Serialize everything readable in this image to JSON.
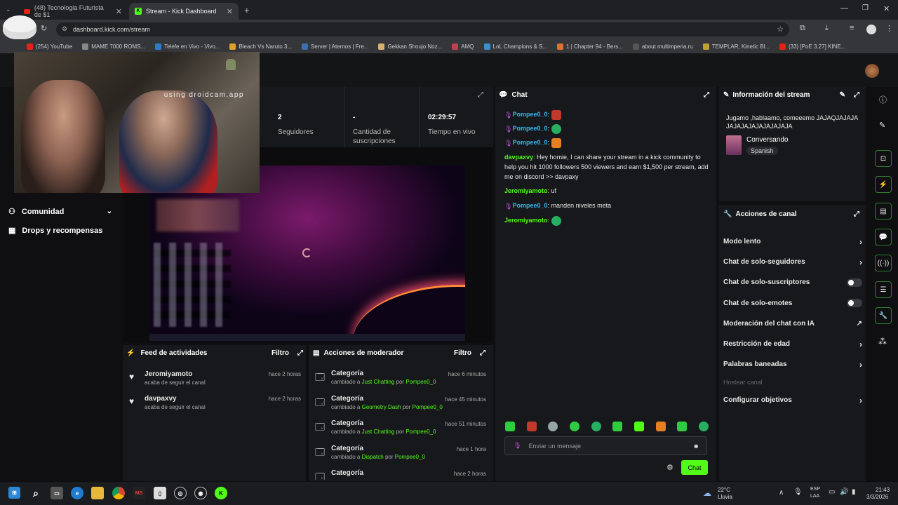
{
  "browser": {
    "tabs": [
      {
        "label": "(48) Tecnologia Futurista de $1",
        "active": false,
        "favicon": "youtube-icon"
      },
      {
        "label": "Stream - Kick Dashboard",
        "active": true,
        "favicon": "kick-icon"
      }
    ],
    "url": "dashboard.kick.com/stream",
    "bookmarks": [
      "(254) YouTube",
      "MAME 7000 ROMS...",
      "Telefe en Vivo - Vivo...",
      "Bleach Vs Naruto 3...",
      "Server | Aternos | Fre...",
      "Gekkan Shoujo Noz...",
      "AMQ",
      "LoL Champions & S...",
      "1 | Chapter 94 - Bers...",
      "about multimperia.ru",
      "TEMPLAR, Kinetic Bl...",
      "(33) [PoE 3.27] KINE..."
    ]
  },
  "webcam": {
    "overlay_text": "using droidcam.app"
  },
  "stats": [
    {
      "value": "2",
      "label": "Seguidores"
    },
    {
      "value": "-",
      "label": "Cantidad de suscripciones"
    },
    {
      "value": "02:29:57",
      "label": "Tiempo en vivo"
    }
  ],
  "nav": [
    {
      "label": "Comunidad",
      "icon": "community-icon"
    },
    {
      "label": "Drops y recompensas",
      "icon": "drops-icon"
    }
  ],
  "activity": {
    "title": "Feed de actividades",
    "filter": "Filtro",
    "items": [
      {
        "user": "Jeromiyamoto",
        "sub": "acaba de seguir el canal",
        "time": "hace 2 horas"
      },
      {
        "user": "davpaxvy",
        "sub": "acaba de seguir el canal",
        "time": "hace 2 horas"
      }
    ]
  },
  "modactions": {
    "title": "Acciones de moderador",
    "filter": "Filtro",
    "items": [
      {
        "title": "Categoría",
        "pre": "cambiado a",
        "cat": "Just Chatting",
        "por": "por",
        "user": "Pompee0_0",
        "time": "hace 6 minutos"
      },
      {
        "title": "Categoría",
        "pre": "cambiado a",
        "cat": "Geometry Dash",
        "por": "por",
        "user": "Pompee0_0",
        "time": "hace 45 minutos"
      },
      {
        "title": "Categoría",
        "pre": "cambiado a",
        "cat": "Just Chatting",
        "por": "por",
        "user": "Pompee0_0",
        "time": "hace 51 minutos"
      },
      {
        "title": "Categoría",
        "pre": "cambiado a",
        "cat": "Dispatch",
        "por": "por",
        "user": "Pompee0_0",
        "time": "hace 1 hora"
      },
      {
        "title": "Categoría",
        "pre": "",
        "cat": "",
        "por": "",
        "user": "",
        "time": "hace 2 horas"
      }
    ]
  },
  "chat": {
    "title": "Chat",
    "messages": [
      {
        "user": "Pompee0_0",
        "badge": true,
        "text": "",
        "emote": "#c0392b"
      },
      {
        "user": "Pompee0_0",
        "badge": true,
        "text": "",
        "emote": "#27ae60"
      },
      {
        "user": "Pompee0_0",
        "badge": true,
        "text": "",
        "emote": "#e67e22"
      },
      {
        "user": "davpaxvy",
        "badge": false,
        "text": "Hey homie, I can share your stream in a kick community to help you hit 1000 followers 500 viewers and earn $1,500 per stream, add me on discord >> davpaxy",
        "emote": ""
      },
      {
        "user": "Jeromiyamoto",
        "badge": false,
        "text": "uf",
        "emote": ""
      },
      {
        "user": "Pompee0_0",
        "badge": true,
        "text": "manden niveles meta",
        "emote": ""
      },
      {
        "user": "Jeromiyamoto",
        "badge": false,
        "text": "",
        "emote": "#27ae60"
      }
    ],
    "emote_bar": [
      "#2ecc40",
      "#c0392b",
      "#95a5a6",
      "#2ecc40",
      "#27ae60",
      "#2ecc40",
      "#53fc18",
      "#e67e22",
      "#2ecc40",
      "#27ae60"
    ],
    "input_placeholder": "Enviar un mensaje",
    "send_label": "Chat"
  },
  "streaminfo": {
    "title": "Información del stream",
    "stream_title": "Jugamo ,hablaamo, comeeemo JAJAQJAJAJAJAJAJAJAJAJAJAJAJA",
    "category": "Conversando",
    "language": "Spanish"
  },
  "channel_actions": {
    "title": "Acciones de canal",
    "items": [
      {
        "label": "Modo lento",
        "control": "arrow"
      },
      {
        "label": "Chat de solo-seguidores",
        "control": "arrow"
      },
      {
        "label": "Chat de solo-suscriptores",
        "control": "toggle"
      },
      {
        "label": "Chat de solo-emotes",
        "control": "toggle"
      },
      {
        "label": "Moderación del chat con IA",
        "control": "external"
      },
      {
        "label": "Restricción de edad",
        "control": "arrow"
      },
      {
        "label": "Palabras baneadas",
        "control": "arrow"
      },
      {
        "label": "Hostear canal",
        "control": "disabled"
      },
      {
        "label": "Configurar objetivos",
        "control": "arrow"
      }
    ]
  },
  "taskbar": {
    "weather_temp": "22°C",
    "weather_desc": "Lluvia",
    "lang": "ESP",
    "lang2": "LAA",
    "time": "21:43",
    "date": "3/3/2026"
  }
}
